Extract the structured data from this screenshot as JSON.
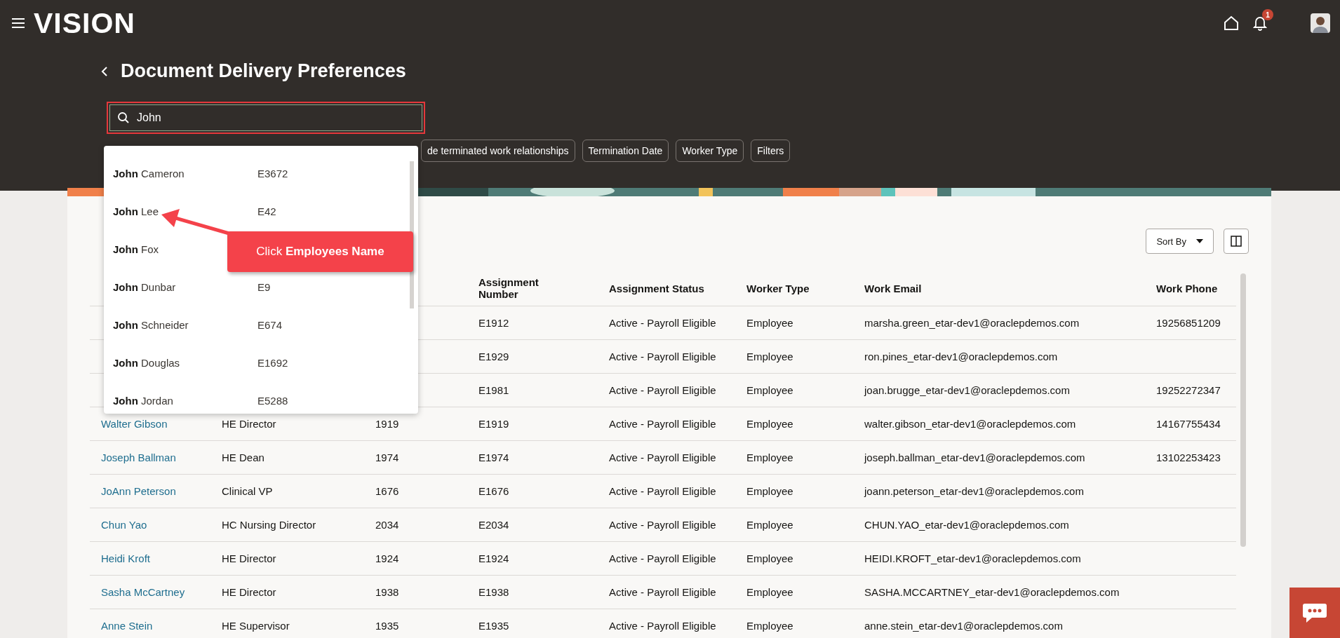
{
  "app": {
    "logo": "VISION",
    "notification_count": "1"
  },
  "page": {
    "title": "Document Delivery Preferences"
  },
  "search": {
    "value": "John"
  },
  "filter_chips": [
    "de terminated work relationships",
    "Termination Date",
    "Worker Type",
    "Filters"
  ],
  "suggestions": [
    {
      "match": "John",
      "rest": "Cameron",
      "number": "E3672"
    },
    {
      "match": "John",
      "rest": "Lee",
      "number": "E42"
    },
    {
      "match": "John",
      "rest": "Fox"
    },
    {
      "match": "John",
      "rest": "Dunbar",
      "number": "E9"
    },
    {
      "match": "John",
      "rest": "Schneider",
      "number": "E674"
    },
    {
      "match": "John",
      "rest": "Douglas",
      "number": "E1692"
    },
    {
      "match": "John",
      "rest": "Jordan",
      "number": "E5288"
    }
  ],
  "callout": {
    "text": "Click **Employees Name**"
  },
  "toolbar": {
    "sort_label": "Sort By"
  },
  "table": {
    "columns": [
      {
        "kind": "hidden"
      },
      {
        "kind": "hidden"
      },
      {
        "kind": "hidden"
      },
      {
        "kind": "text",
        "label": "Assignment Number"
      },
      {
        "kind": "text",
        "label": "Assignment Status"
      },
      {
        "kind": "text",
        "label": "Worker Type"
      },
      {
        "kind": "text",
        "label": "Work Email"
      },
      {
        "kind": "text",
        "label": "Work Phone"
      }
    ],
    "rows": [
      [
        null,
        null,
        null,
        "E1912",
        "Active - Payroll Eligible",
        "Employee",
        "marsha.green_etar-dev1@oraclepdemos.com",
        "19256851209"
      ],
      [
        null,
        null,
        null,
        "E1929",
        "Active - Payroll Eligible",
        "Employee",
        "ron.pines_etar-dev1@oraclepdemos.com",
        null
      ],
      [
        null,
        null,
        null,
        "E1981",
        "Active - Payroll Eligible",
        "Employee",
        "joan.brugge_etar-dev1@oraclepdemos.com",
        "19252272347"
      ],
      [
        "Walter Gibson",
        "HE Director",
        "1919",
        "E1919",
        "Active - Payroll Eligible",
        "Employee",
        "walter.gibson_etar-dev1@oraclepdemos.com",
        "14167755434"
      ],
      [
        "Joseph Ballman",
        "HE Dean",
        "1974",
        "E1974",
        "Active - Payroll Eligible",
        "Employee",
        "joseph.ballman_etar-dev1@oraclepdemos.com",
        "13102253423"
      ],
      [
        "JoAnn Peterson",
        "Clinical VP",
        "1676",
        "E1676",
        "Active - Payroll Eligible",
        "Employee",
        "joann.peterson_etar-dev1@oraclepdemos.com",
        null
      ],
      [
        "Chun Yao",
        "HC Nursing Director",
        "2034",
        "E2034",
        "Active - Payroll Eligible",
        "Employee",
        "CHUN.YAO_etar-dev1@oraclepdemos.com",
        null
      ],
      [
        "Heidi Kroft",
        "HE Director",
        "1924",
        "E1924",
        "Active - Payroll Eligible",
        "Employee",
        "HEIDI.KROFT_etar-dev1@oraclepdemos.com",
        null
      ],
      [
        "Sasha McCartney",
        "HE Director",
        "1938",
        "E1938",
        "Active - Payroll Eligible",
        "Employee",
        "SASHA.MCCARTNEY_etar-dev1@oraclepdemos.com",
        null
      ],
      [
        "Anne Stein",
        "HE Supervisor",
        "1935",
        "E1935",
        "Active - Payroll Eligible",
        "Employee",
        "anne.stein_etar-dev1@oraclepdemos.com",
        null
      ]
    ]
  }
}
